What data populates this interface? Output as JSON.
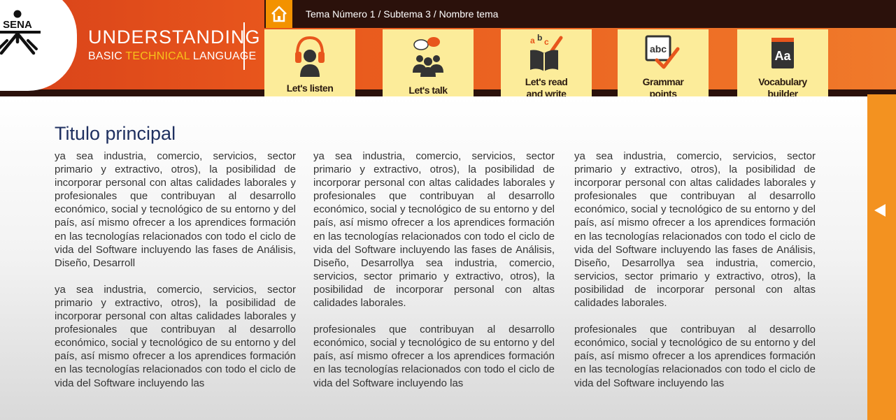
{
  "brand": {
    "logo_text": "SENA",
    "title": "UNDERSTANDING",
    "subtitle_part1": "BASIC ",
    "subtitle_accent": "TECHNICAL",
    "subtitle_part2": " LANGUAGE"
  },
  "breadcrumb": "Tema Número 1 / Subtema 3 / Nombre tema",
  "nav": [
    {
      "label_line1": "Let's listen",
      "label_line2": "",
      "icon": "headphones-icon"
    },
    {
      "label_line1": "Let's talk",
      "label_line2": "",
      "icon": "people-talking-icon"
    },
    {
      "label_line1": "Let's read",
      "label_line2": "and write",
      "icon": "book-pencil-icon"
    },
    {
      "label_line1": "Grammar",
      "label_line2": "points",
      "icon": "abc-check-icon"
    },
    {
      "label_line1": "Vocabulary",
      "label_line2": "builder",
      "icon": "dictionary-icon"
    }
  ],
  "main": {
    "title": "Titulo principal",
    "columns": [
      {
        "p1": "ya sea industria, comercio, servicios, sector primario y extractivo, otros), la posibilidad de incorporar personal con altas calidades laborales y profesionales que contribuyan al desarrollo económico, social y tecnológico de su entorno y del país, así mismo ofrecer a los aprendices formación en las tecnologías relacionados con todo el ciclo de vida del Software incluyendo las fases de Análisis, Diseño, Desarroll",
        "p2": "ya sea industria, comercio, servicios, sector primario y extractivo, otros), la posibilidad de incorporar personal con altas calidades laborales y profesionales que contribuyan al desarrollo económico, social y tecnológico de su entorno y del país, así mismo ofrecer a los aprendices formación en las tecnologías relacionados con todo el ciclo de vida del Software incluyendo las"
      },
      {
        "p1": "ya sea industria, comercio, servicios, sector primario y extractivo, otros), la posibilidad de incorporar personal con altas calidades laborales y profesionales que contribuyan al desarrollo económico, social y tecnológico de su entorno y del país, así mismo ofrecer a los aprendices formación en las tecnologías relacionados con todo el ciclo de vida del Software incluyendo las fases de Análisis, Diseño, Desarrollya sea industria, comercio, servicios, sector primario y extractivo, otros), la posibilidad de incorporar personal con altas calidades laborales.",
        "p2": "profesionales que contribuyan al desarrollo económico, social y tecnológico de su entorno y del país, así mismo ofrecer a los aprendices formación en las tecnologías relacionados con todo el ciclo de vida del Software incluyendo las"
      },
      {
        "p1": "ya sea industria, comercio, servicios, sector primario y extractivo, otros), la posibilidad de incorporar personal con altas calidades laborales y profesionales que contribuyan al desarrollo económico, social y tecnológico de su entorno y del país, así mismo ofrecer a los aprendices formación en las tecnologías relacionados con todo el ciclo de vida del Software incluyendo las fases de Análisis, Diseño, Desarrollya sea industria, comercio, servicios, sector primario y extractivo, otros), la posibilidad de incorporar personal con altas calidades laborales.",
        "p2": "profesionales que contribuyan al desarrollo económico, social y tecnológico de su entorno y del país, así mismo ofrecer a los aprendices formación en las tecnologías relacionados con todo el ciclo de vida del Software incluyendo las"
      }
    ]
  },
  "side_panel": {
    "icon": "triangle-left-icon"
  },
  "colors": {
    "orange": "#f39200",
    "dark": "#2b110b",
    "tile": "#fcec9a",
    "title_blue": "#1f3060"
  }
}
